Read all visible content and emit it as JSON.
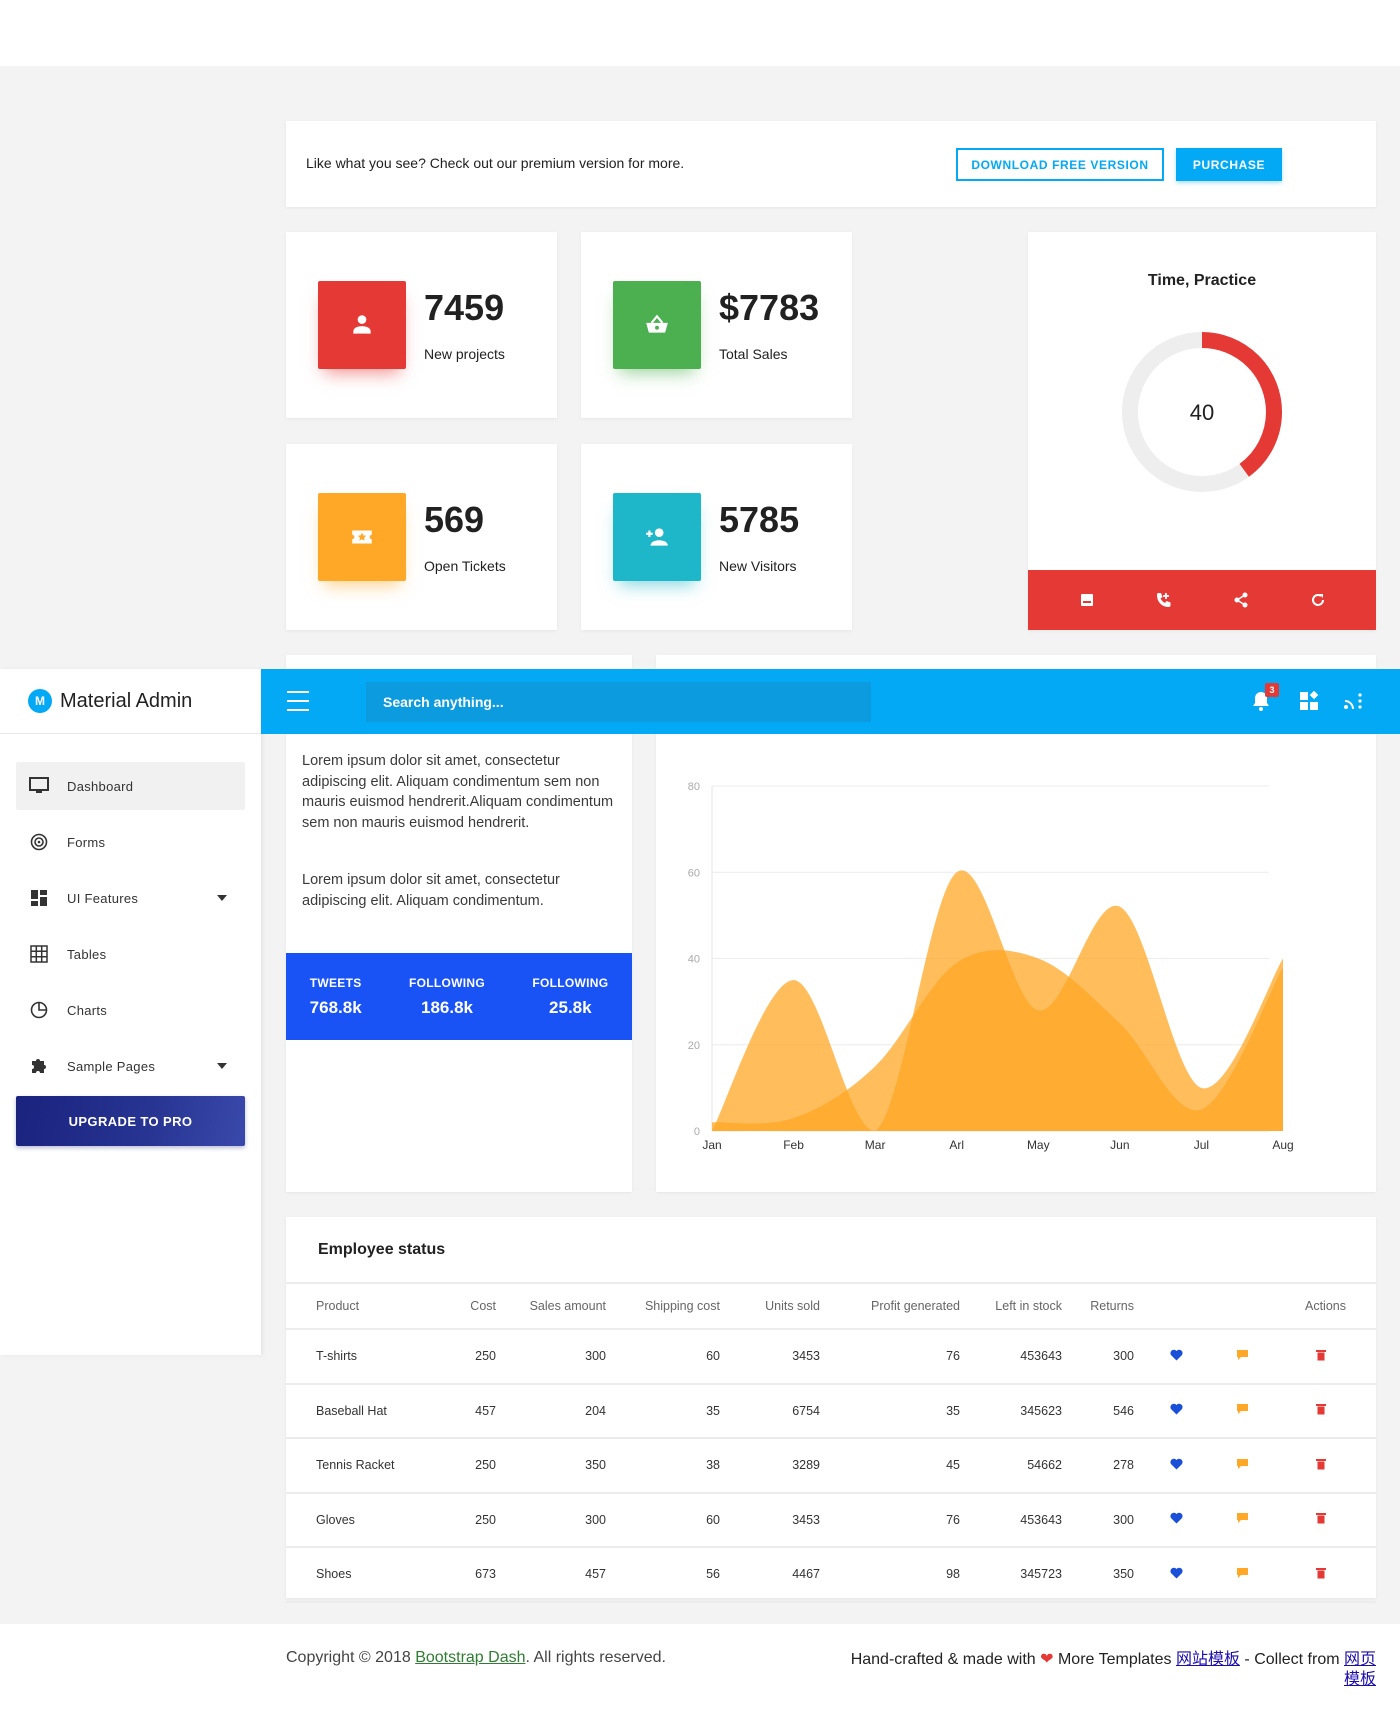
{
  "banner": {
    "text": "Like what you see? Check out our premium version for more.",
    "download_label": "DOWNLOAD FREE VERSION",
    "purchase_label": "PURCHASE"
  },
  "stats": [
    {
      "value": "7459",
      "label": "New projects",
      "color": "#e53935",
      "icon": "user-tie-icon"
    },
    {
      "value": "$7783",
      "label": "Total Sales",
      "color": "#4caf50",
      "icon": "basket-icon"
    },
    {
      "value": "569",
      "label": "Open Tickets",
      "color": "#ffa726",
      "icon": "ticket-icon"
    },
    {
      "value": "5785",
      "label": "New Visitors",
      "color": "#1eb6c9",
      "icon": "add-user-icon"
    }
  ],
  "donut": {
    "title": "Time, Practice",
    "value": "40",
    "fraction": 0.4,
    "color": "#e53935",
    "track_color": "#eeeeee",
    "actions": [
      "inbox-icon",
      "phone-icon",
      "share-icon",
      "refresh-icon"
    ]
  },
  "text_card": {
    "paragraph1": "Lorem ipsum dolor sit amet, consectetur adipiscing elit. Aliquam condimentum sem non mauris euismod hendrerit.Aliquam condimentum sem non mauris euismod hendrerit.",
    "paragraph2": "Lorem ipsum dolor sit amet, consectetur adipiscing elit. Aliquam condimentum.",
    "social": [
      {
        "label": "TWEETS",
        "value": "768.8k"
      },
      {
        "label": "FOLLOWING",
        "value": "186.8k"
      },
      {
        "label": "FOLLOWING",
        "value": "25.8k"
      }
    ]
  },
  "chart_data": {
    "type": "area",
    "categories": [
      "Jan",
      "Feb",
      "Mar",
      "Arl",
      "May",
      "Jun",
      "Jul",
      "Aug"
    ],
    "ylim": [
      0,
      80
    ],
    "yticks": [
      0,
      20,
      40,
      60,
      80
    ],
    "grid": true,
    "series": [
      {
        "color": "#ffa726",
        "values": [
          0,
          35,
          0,
          60,
          28,
          52,
          10,
          40
        ]
      },
      {
        "color": "#ffa726",
        "values": [
          2,
          3,
          15,
          39,
          40,
          25,
          5,
          38
        ]
      }
    ]
  },
  "sidebar": {
    "brand_logo": "M",
    "brand": "Material Admin",
    "items": [
      {
        "label": "Dashboard",
        "icon": "monitor-icon",
        "active": true,
        "caret": false
      },
      {
        "label": "Forms",
        "icon": "target-icon",
        "active": false,
        "caret": false
      },
      {
        "label": "UI Features",
        "icon": "dashboard-grid-icon",
        "active": false,
        "caret": true
      },
      {
        "label": "Tables",
        "icon": "table-icon",
        "active": false,
        "caret": false
      },
      {
        "label": "Charts",
        "icon": "pie-chart-icon",
        "active": false,
        "caret": false
      },
      {
        "label": "Sample Pages",
        "icon": "puzzle-icon",
        "active": false,
        "caret": true
      }
    ],
    "upgrade_label": "UPGRADE TO PRO"
  },
  "topbar": {
    "search_placeholder": "Search anything...",
    "notification_count": "3"
  },
  "table": {
    "title": "Employee status",
    "columns": [
      "Product",
      "Cost",
      "Sales amount",
      "Shipping cost",
      "Units sold",
      "Profit generated",
      "Left in stock",
      "Returns",
      "Actions"
    ],
    "rows": [
      [
        "T-shirts",
        "250",
        "300",
        "60",
        "3453",
        "76",
        "453643",
        "300"
      ],
      [
        "Baseball Hat",
        "457",
        "204",
        "35",
        "6754",
        "35",
        "345623",
        "546"
      ],
      [
        "Tennis Racket",
        "250",
        "350",
        "38",
        "3289",
        "45",
        "54662",
        "278"
      ],
      [
        "Gloves",
        "250",
        "300",
        "60",
        "3453",
        "76",
        "453643",
        "300"
      ],
      [
        "Shoes",
        "673",
        "457",
        "56",
        "4467",
        "98",
        "345723",
        "350"
      ]
    ]
  },
  "footer": {
    "copyright_prefix": "Copyright © 2018 ",
    "copyright_link": "Bootstrap Dash",
    "copyright_suffix": ". All rights reserved.",
    "handcrafted": "Hand-crafted & made with ",
    "more_templates": " More Templates ",
    "link1": "网站模板",
    "collect": " - Collect from ",
    "link2": "网页模板"
  }
}
